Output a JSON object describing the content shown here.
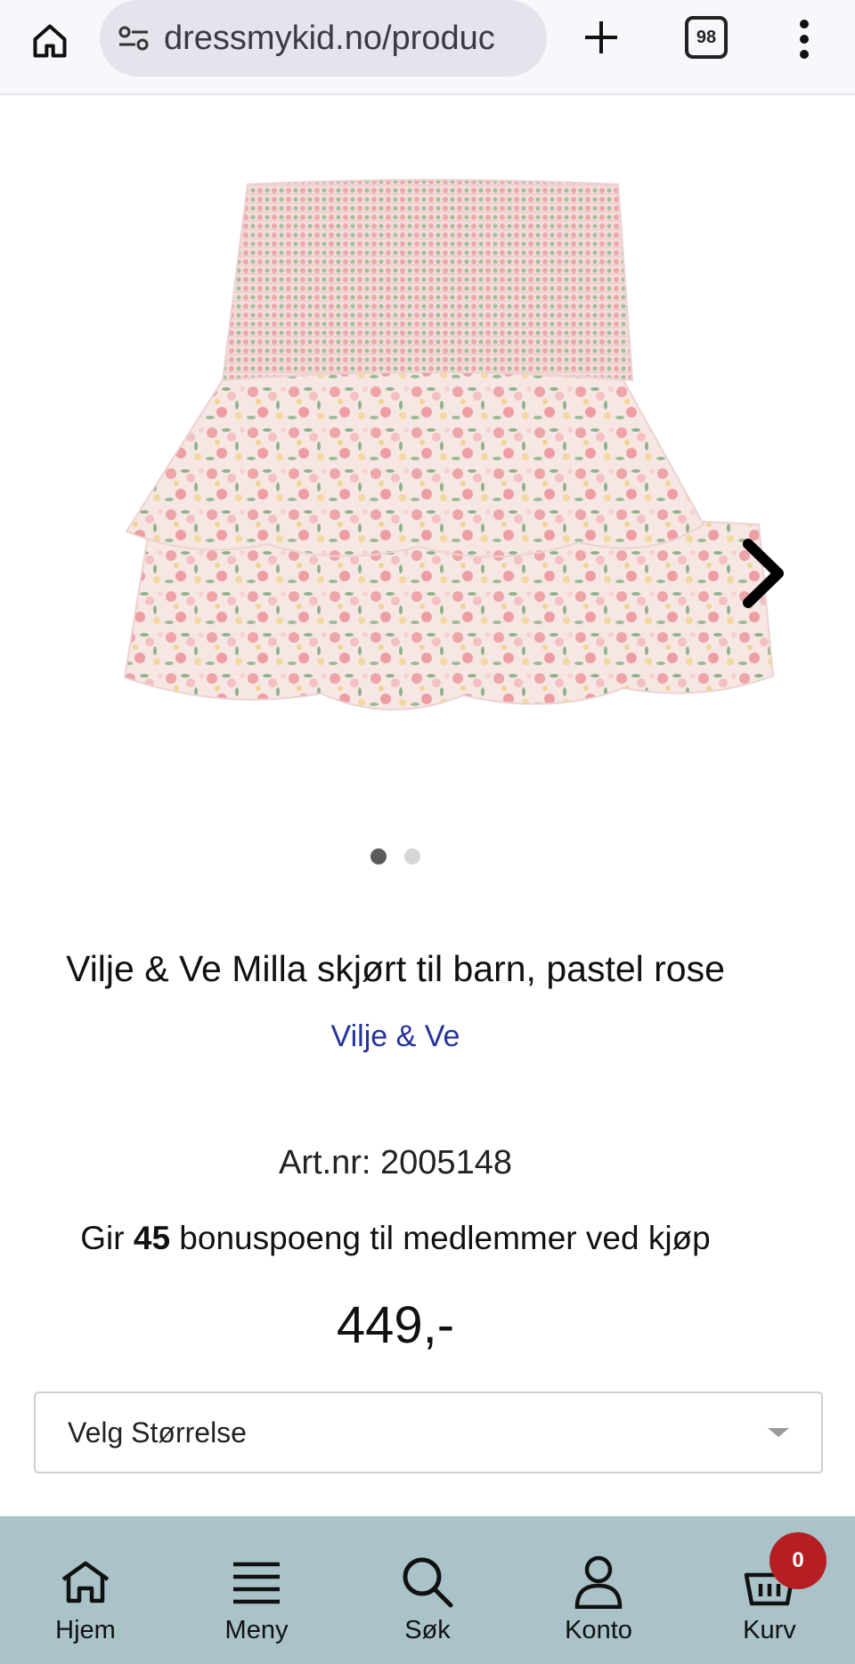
{
  "browser": {
    "url": "dressmykid.no/produc",
    "tab_count": "98"
  },
  "product": {
    "image_alt": "Vilje & Ve Milla skjørt til barn, pastel rose",
    "title": "Vilje & Ve Milla skjørt til barn, pastel rose",
    "brand": "Vilje & Ve",
    "artnr": "Art.nr: 2005148",
    "bonus_prefix": "Gir ",
    "bonus_points": "45",
    "bonus_suffix": " bonuspoeng til medlemmer ved kjøp",
    "price": "449,-",
    "size_placeholder": "Velg Størrelse",
    "gallery_active_index": 0,
    "gallery_count": 2
  },
  "bottom_nav": {
    "items": [
      {
        "label": "Hjem",
        "icon": "home-icon"
      },
      {
        "label": "Meny",
        "icon": "menu-icon"
      },
      {
        "label": "Søk",
        "icon": "search-icon"
      },
      {
        "label": "Konto",
        "icon": "account-icon"
      },
      {
        "label": "Kurv",
        "icon": "basket-icon"
      }
    ],
    "cart_count": "0"
  },
  "colors": {
    "nav_bg": "#a9c3c9",
    "brand_link": "#25329c",
    "badge": "#b51f23"
  }
}
